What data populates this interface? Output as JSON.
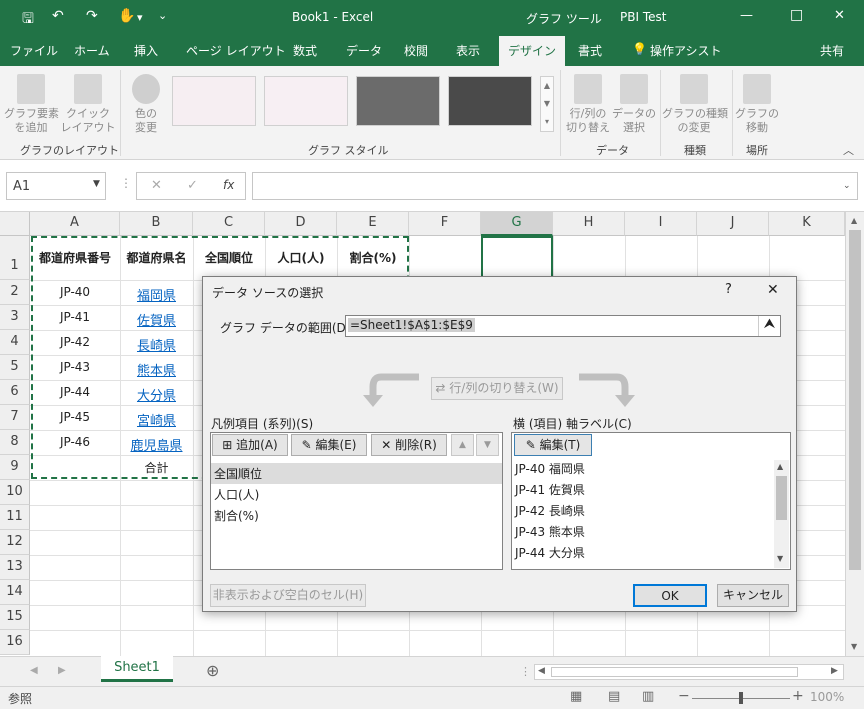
{
  "window": {
    "title": "Book1  -  Excel",
    "context_tab": "グラフ ツール",
    "user": "PBI Test",
    "minimize": "—",
    "restore": "□",
    "close": "✕"
  },
  "quick_access": {
    "save": "🖫",
    "undo": "↶",
    "redo": "↷",
    "touch": "✋",
    "more": "▾",
    "customize": "⌄"
  },
  "tabs": [
    "ファイル",
    "ホーム",
    "挿入",
    "ページ レイアウト",
    "数式",
    "データ",
    "校閲",
    "表示",
    "デザイン",
    "書式"
  ],
  "active_tab": "デザイン",
  "tell_me": "操作アシスト",
  "share": "共有",
  "ribbon": {
    "add_element": "グラフ要素\nを追加",
    "quick_layout": "クイック\nレイアウト",
    "change_colors": "色の\n変更",
    "group_layout": "グラフのレイアウト",
    "group_styles": "グラフ スタイル",
    "switch_rowcol": "行/列の\n切り替え",
    "select_data": "データの\n選択",
    "group_data": "データ",
    "change_type": "グラフの種類\nの変更",
    "group_type": "種類",
    "move_chart": "グラフの\n移動",
    "group_location": "場所"
  },
  "formula_bar": {
    "name_box": "A1",
    "cancel": "✕",
    "enter": "✓",
    "fx": "fx",
    "formula": ""
  },
  "columns": [
    "A",
    "B",
    "C",
    "D",
    "E",
    "F",
    "G",
    "H",
    "I",
    "J",
    "K"
  ],
  "rows": [
    "1",
    "2",
    "3",
    "4",
    "5",
    "6",
    "7",
    "8",
    "9",
    "10",
    "11",
    "12",
    "13",
    "14",
    "15",
    "16"
  ],
  "cells": {
    "headers": [
      "都道府県番号",
      "都道府県名",
      "全国順位",
      "人口(人)",
      "割合(%)"
    ],
    "codes": [
      "JP-40",
      "JP-41",
      "JP-42",
      "JP-43",
      "JP-44",
      "JP-45",
      "JP-46"
    ],
    "names": [
      "福岡県",
      "佐賀県",
      "長崎県",
      "熊本県",
      "大分県",
      "宮崎県",
      "鹿児島県"
    ],
    "total": "合計"
  },
  "dialog": {
    "title": "データ ソースの選択",
    "help": "?",
    "close": "✕",
    "range_label": "グラフ データの範囲(D):",
    "range_value": "=Sheet1!$A$1:$E$9",
    "switch_button": "行/列の切り替え(W)",
    "legend_label": "凡例項目 (系列)(S)",
    "add": "追加(A)",
    "edit": "編集(E)",
    "delete": "削除(R)",
    "up": "▲",
    "down": "▼",
    "series": [
      "全国順位",
      "人口(人)",
      "割合(%)"
    ],
    "axis_label": "横 (項目) 軸ラベル(C)",
    "axis_edit": "編集(T)",
    "axis_items": [
      "JP-40 福岡県",
      "JP-41 佐賀県",
      "JP-42 長崎県",
      "JP-43 熊本県",
      "JP-44 大分県"
    ],
    "hidden_cells": "非表示および空白のセル(H)",
    "ok": "OK",
    "cancel": "キャンセル"
  },
  "sheet_tabs": [
    "Sheet1"
  ],
  "add_sheet": "⊕",
  "status": {
    "mode": "参照",
    "zoom": "100%"
  },
  "colors": {
    "excel_green": "#217346",
    "link": "#0563c1",
    "selection": "#217346"
  }
}
